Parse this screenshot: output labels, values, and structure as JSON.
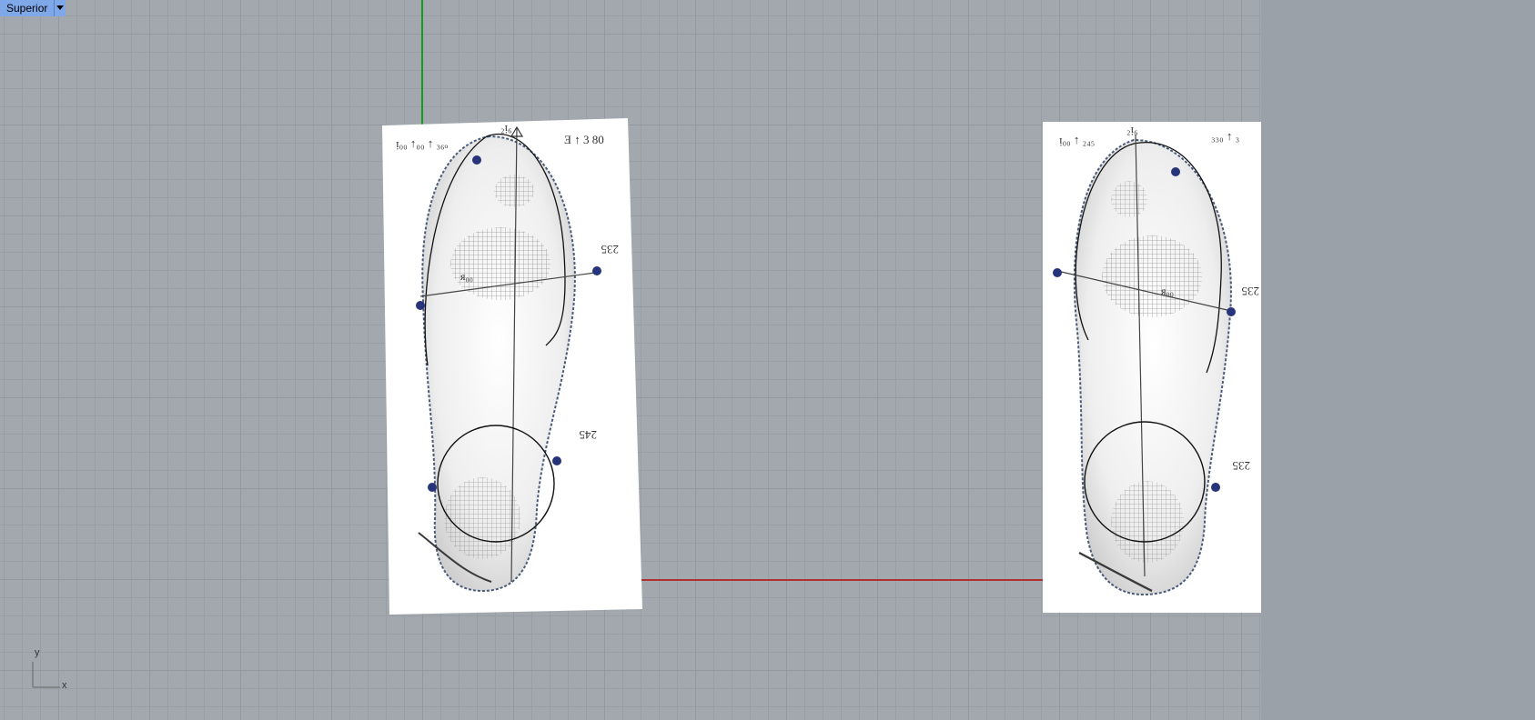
{
  "viewport": {
    "label": "Superior",
    "label_menu_icon": "triangle-down-icon",
    "colors": {
      "grid_background": "#a3a8ae",
      "label_background": "#7fa8e8",
      "x_axis": "#b03030",
      "y_axis": "#1a9a1a"
    }
  },
  "left_insole": {
    "annotations": {
      "top_left": "ᴉ₀₀ ↑₀₀ ↑ ₃₆ₒ",
      "top_center": "₂ᴉ₆",
      "top_right": "Ǝ ↑ 3 80",
      "side_upper": "235",
      "side_lower": "245",
      "center_mark": "ᴙ₀₀"
    }
  },
  "right_insole": {
    "annotations": {
      "top_left": "ᴉ₀₀ ↑ ₂₄₅",
      "top_center": "₂ᴉ₆",
      "top_right": "₃₃₀ ↑ ₃",
      "side_upper": "235",
      "side_lower": "235",
      "center_mark": "ᴙ₀₀"
    }
  },
  "axis_widget": {
    "x_label": "x",
    "y_label": "y"
  }
}
